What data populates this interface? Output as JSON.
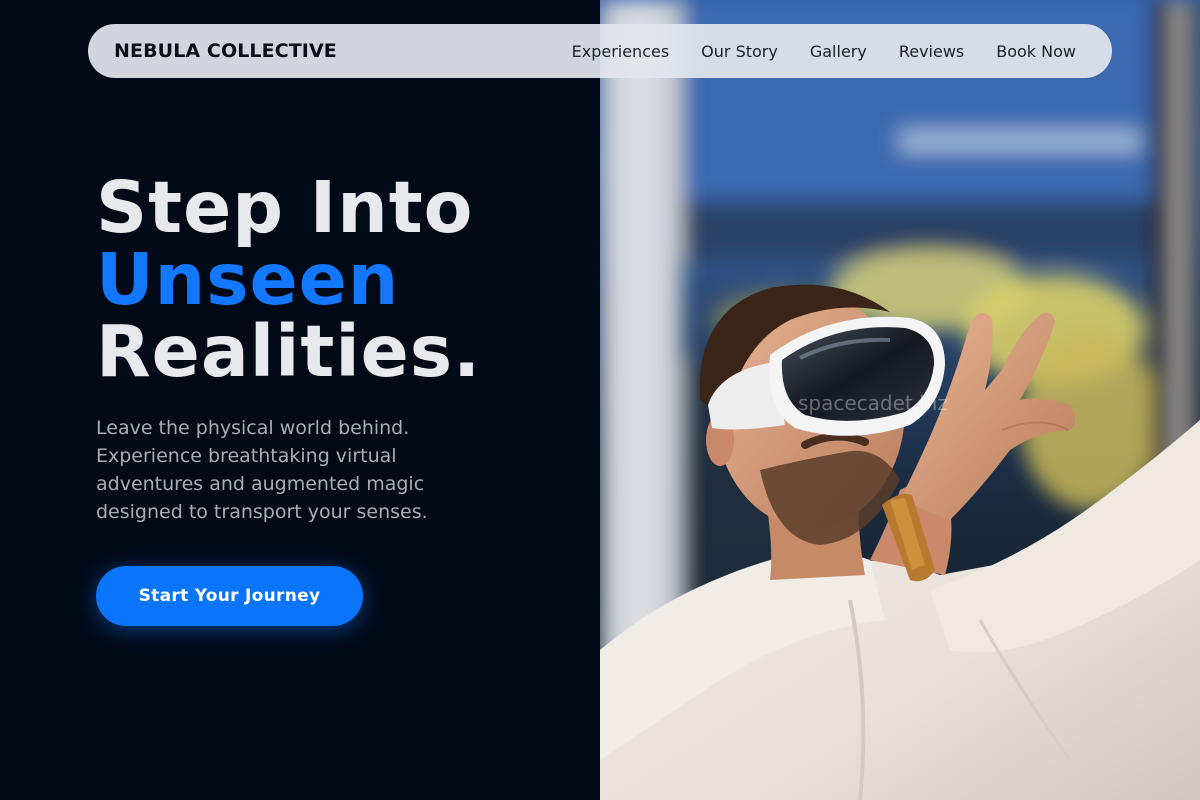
{
  "nav": {
    "brand": "NEBULA COLLECTIVE",
    "links": [
      "Experiences",
      "Our Story",
      "Gallery",
      "Reviews",
      "Book Now"
    ]
  },
  "hero": {
    "title_line1": "Step Into",
    "title_line2": "Unseen",
    "title_line3": "Realities.",
    "description": "Leave the physical world behind. Experience breathtaking virtual adventures and augmented magic designed to transport your senses.",
    "cta_label": "Start Your Journey",
    "image_watermark": "spacecadet.biz"
  },
  "colors": {
    "background": "#020a17",
    "accent": "#1478ff",
    "button": "#0a74fb",
    "nav_background": "#e2e6ec"
  }
}
